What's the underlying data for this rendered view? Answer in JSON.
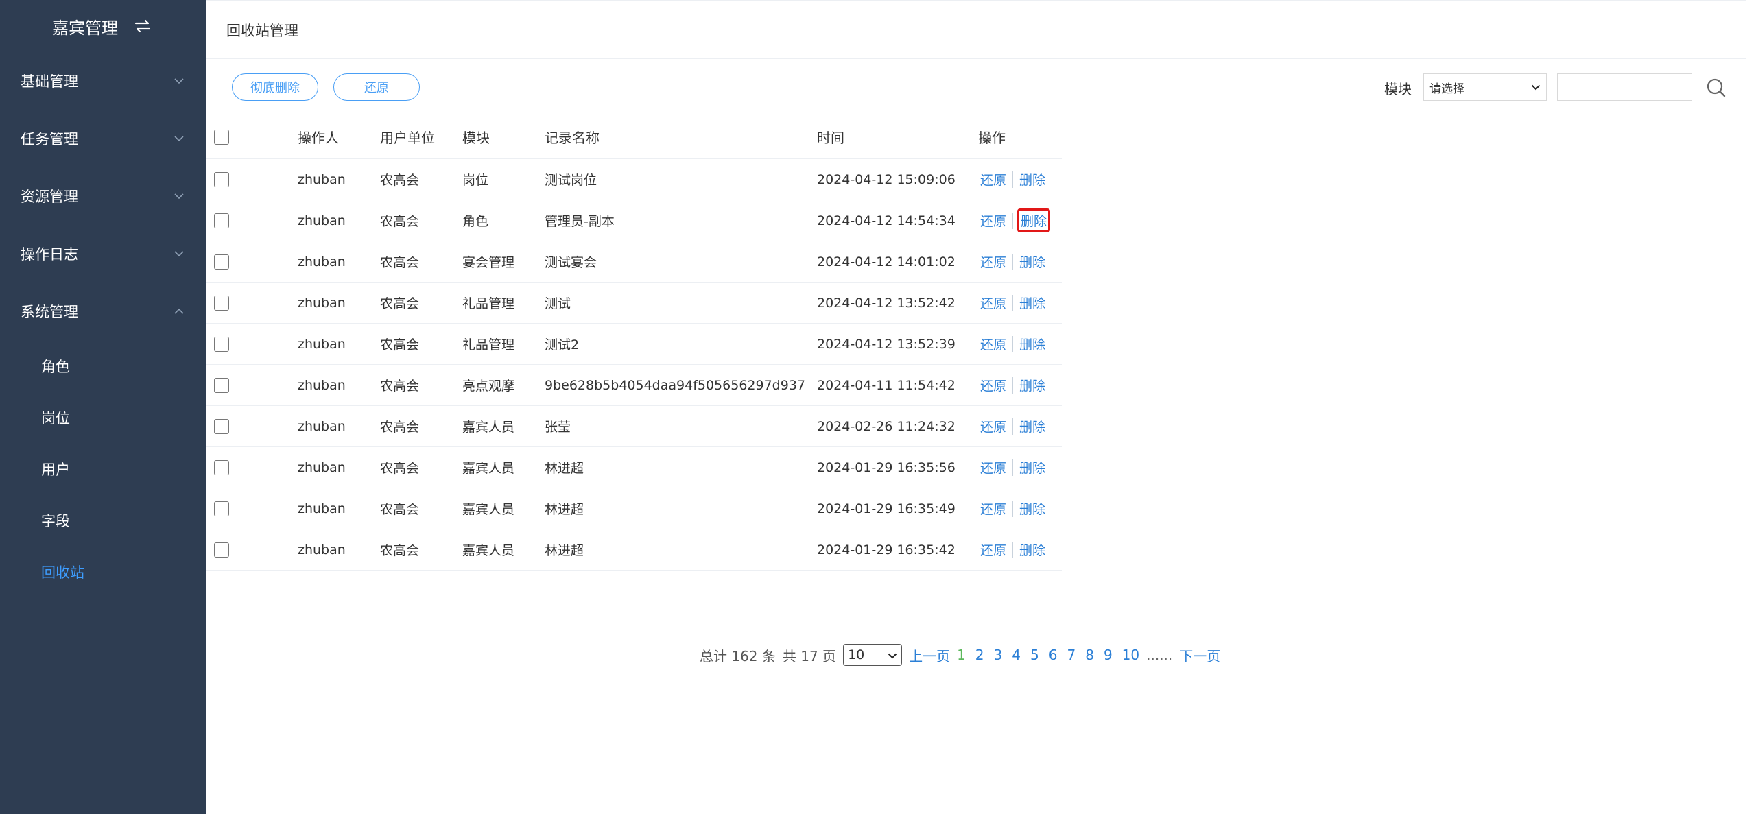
{
  "sidebar": {
    "brand": "嘉宾管理",
    "menus": [
      {
        "label": "基础管理",
        "expanded": false
      },
      {
        "label": "任务管理",
        "expanded": false
      },
      {
        "label": "资源管理",
        "expanded": false
      },
      {
        "label": "操作日志",
        "expanded": false
      },
      {
        "label": "系统管理",
        "expanded": true
      }
    ],
    "sub_items": [
      "角色",
      "岗位",
      "用户",
      "字段",
      "回收站"
    ],
    "active_sub": "回收站"
  },
  "page": {
    "title": "回收站管理"
  },
  "toolbar": {
    "delete_label": "彻底删除",
    "restore_label": "还原",
    "filter_label": "模块",
    "select_value": "请选择",
    "search_value": ""
  },
  "table": {
    "headers": [
      "操作人",
      "用户单位",
      "模块",
      "记录名称",
      "时间",
      "操作"
    ],
    "action_restore": "还原",
    "action_delete": "删除",
    "rows": [
      {
        "operator": "zhuban",
        "unit": "农高会",
        "module": "岗位",
        "name": "测试岗位",
        "time": "2024-04-12 15:09:06"
      },
      {
        "operator": "zhuban",
        "unit": "农高会",
        "module": "角色",
        "name": "管理员-副本",
        "time": "2024-04-12 14:54:34"
      },
      {
        "operator": "zhuban",
        "unit": "农高会",
        "module": "宴会管理",
        "name": "测试宴会",
        "time": "2024-04-12 14:01:02"
      },
      {
        "operator": "zhuban",
        "unit": "农高会",
        "module": "礼品管理",
        "name": "测试",
        "time": "2024-04-12 13:52:42"
      },
      {
        "operator": "zhuban",
        "unit": "农高会",
        "module": "礼品管理",
        "name": "测试2",
        "time": "2024-04-12 13:52:39"
      },
      {
        "operator": "zhuban",
        "unit": "农高会",
        "module": "亮点观摩",
        "name": "9be628b5b4054daa94f505656297d937",
        "time": "2024-04-11 11:54:42"
      },
      {
        "operator": "zhuban",
        "unit": "农高会",
        "module": "嘉宾人员",
        "name": "张莹",
        "time": "2024-02-26 11:24:32"
      },
      {
        "operator": "zhuban",
        "unit": "农高会",
        "module": "嘉宾人员",
        "name": "林进超",
        "time": "2024-01-29 16:35:56"
      },
      {
        "operator": "zhuban",
        "unit": "农高会",
        "module": "嘉宾人员",
        "name": "林进超",
        "time": "2024-01-29 16:35:49"
      },
      {
        "operator": "zhuban",
        "unit": "农高会",
        "module": "嘉宾人员",
        "name": "林进超",
        "time": "2024-01-29 16:35:42"
      }
    ]
  },
  "pagination": {
    "total_text": "总计 162 条",
    "pages_text": "共 17 页",
    "page_size": "10",
    "prev": "上一页",
    "pages": [
      "1",
      "2",
      "3",
      "4",
      "5",
      "6",
      "7",
      "8",
      "9",
      "10"
    ],
    "current": "1",
    "ellipsis": "......",
    "next": "下一页"
  },
  "colors": {
    "sidebar_bg": "#2e3d52",
    "accent": "#4a9ff5",
    "link": "#2b7fd6",
    "current_page": "#5cb85c",
    "highlight_box": "#e21818"
  }
}
